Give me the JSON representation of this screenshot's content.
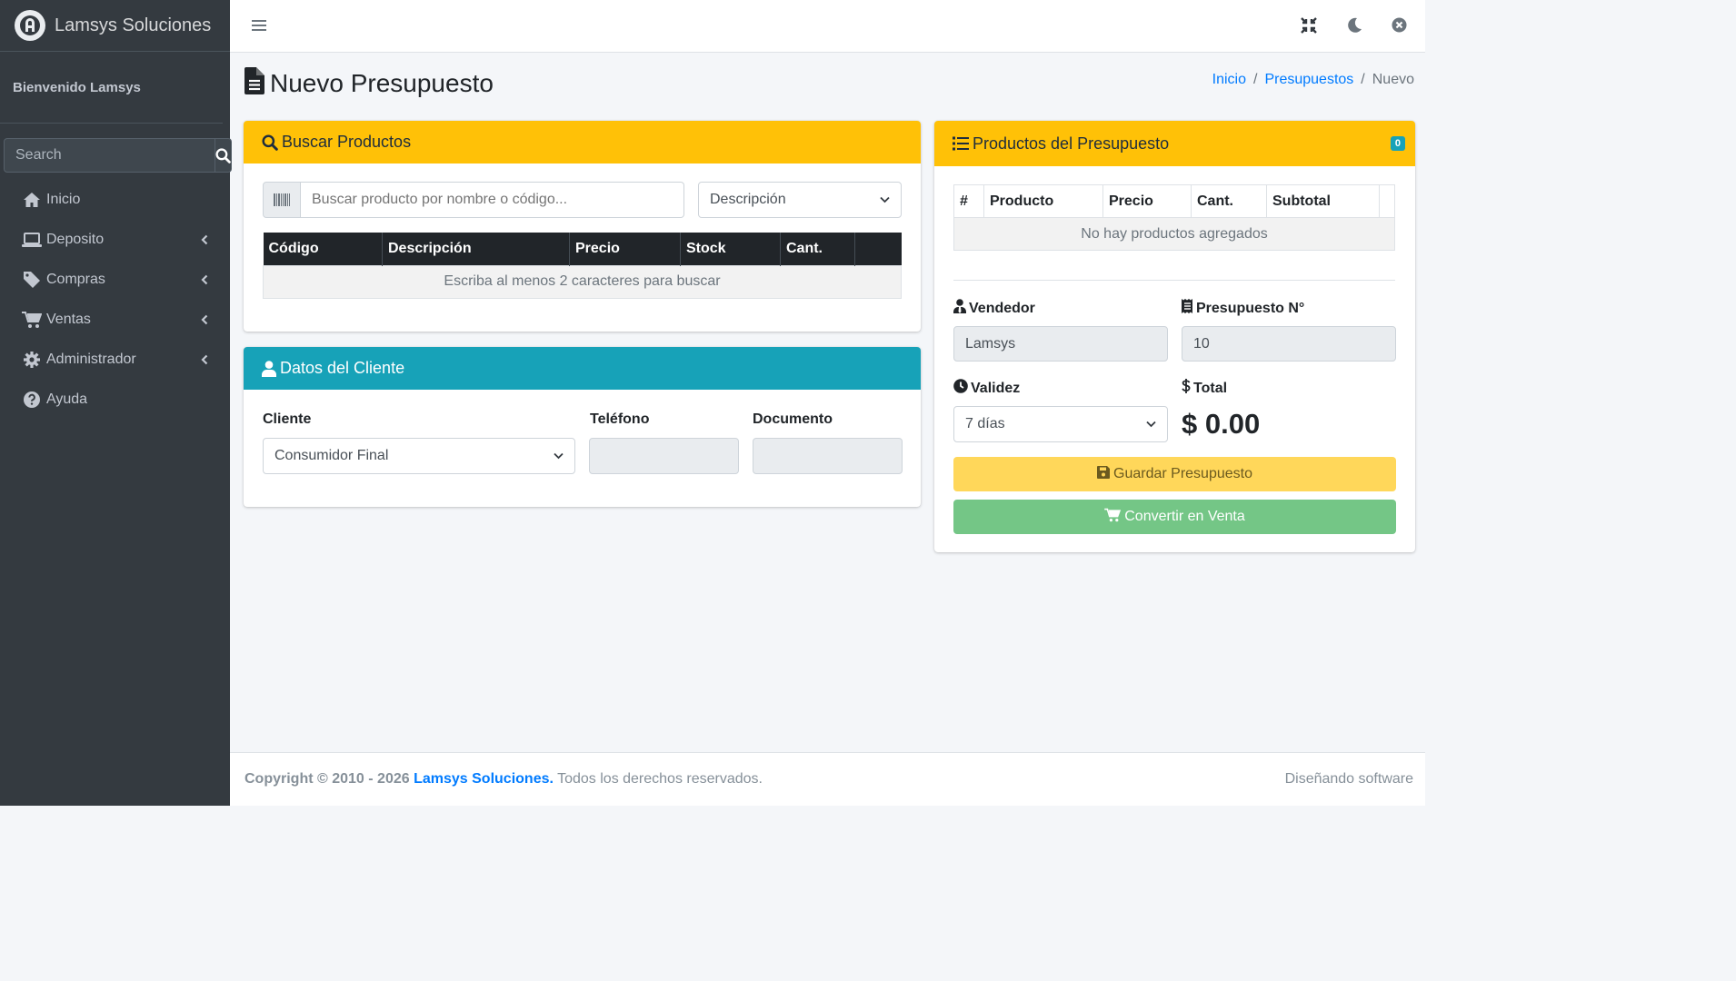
{
  "brand": {
    "name": "Lamsys Soluciones"
  },
  "sidebar": {
    "welcome": "Bienvenido Lamsys",
    "search_placeholder": "Search",
    "items": [
      {
        "label": "Inicio",
        "icon": "home-icon",
        "has_children": false
      },
      {
        "label": "Deposito",
        "icon": "laptop-icon",
        "has_children": true
      },
      {
        "label": "Compras",
        "icon": "tag-icon",
        "has_children": true
      },
      {
        "label": "Ventas",
        "icon": "cart-icon",
        "has_children": true
      },
      {
        "label": "Administrador",
        "icon": "gear-icon",
        "has_children": true
      },
      {
        "label": "Ayuda",
        "icon": "help-icon",
        "has_children": false
      }
    ]
  },
  "topbar": {
    "icons": [
      "menu-icon",
      "fullscreen-exit-icon",
      "moon-icon",
      "close-circle-icon"
    ]
  },
  "page": {
    "title": "Nuevo Presupuesto",
    "breadcrumb": {
      "home": "Inicio",
      "section": "Presupuestos",
      "current": "Nuevo"
    }
  },
  "buscar": {
    "title": "Buscar Productos",
    "search_placeholder": "Buscar producto por nombre o código...",
    "filter_selected": "Descripción",
    "columns": [
      "Código",
      "Descripción",
      "Precio",
      "Stock",
      "Cant."
    ],
    "empty_message": "Escriba al menos 2 caracteres para buscar"
  },
  "cliente": {
    "title": "Datos del Cliente",
    "cliente_label": "Cliente",
    "cliente_selected": "Consumidor Final",
    "telefono_label": "Teléfono",
    "telefono_value": "",
    "documento_label": "Documento",
    "documento_value": ""
  },
  "presupuesto": {
    "title": "Productos del Presupuesto",
    "badge_count": "0",
    "columns": [
      "#",
      "Producto",
      "Precio",
      "Cant.",
      "Subtotal"
    ],
    "empty_message": "No hay productos agregados",
    "vendedor_label": "Vendedor",
    "vendedor_value": "Lamsys",
    "numero_label": "Presupuesto N°",
    "numero_value": "10",
    "validez_label": "Validez",
    "validez_selected": "7 días",
    "total_label": "Total",
    "total_value": "$ 0.00",
    "save_label": "Guardar Presupuesto",
    "convert_label": "Convertir en Venta"
  },
  "footer": {
    "copyright": "Copyright © 2010 - 2026",
    "company": "Lamsys Soluciones.",
    "rights": "Todos los derechos reservados.",
    "right_text": "Diseñando software"
  },
  "colors": {
    "sidebar": "#343a40",
    "warning": "#ffc107",
    "info": "#17a2b8",
    "primary": "#007bff",
    "save_button": "#ffd75a",
    "convert_button": "#74c686"
  }
}
